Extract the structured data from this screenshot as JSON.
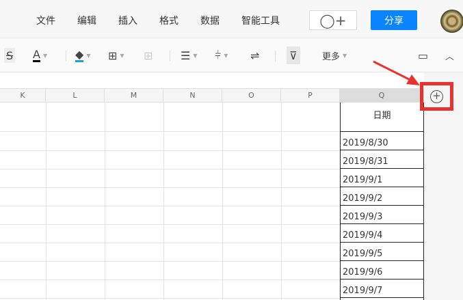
{
  "menu": {
    "items": [
      "文件",
      "编辑",
      "插入",
      "格式",
      "数据",
      "智能工具"
    ],
    "invite_icon": "add-user-icon",
    "share_label": "分享"
  },
  "toolbar": {
    "more_label": "更多",
    "font_color": "#000000",
    "fill_color": "#1aa0e8"
  },
  "columns": [
    "K",
    "L",
    "M",
    "N",
    "O",
    "P",
    "Q"
  ],
  "sheet": {
    "header": "日期",
    "dates": [
      "2019/8/30",
      "2019/8/31",
      "2019/9/1",
      "2019/9/2",
      "2019/9/3",
      "2019/9/4",
      "2019/9/5",
      "2019/9/6",
      "2019/9/7"
    ]
  },
  "annotation": {
    "color": "#e8322f",
    "plus_symbol": "+"
  }
}
